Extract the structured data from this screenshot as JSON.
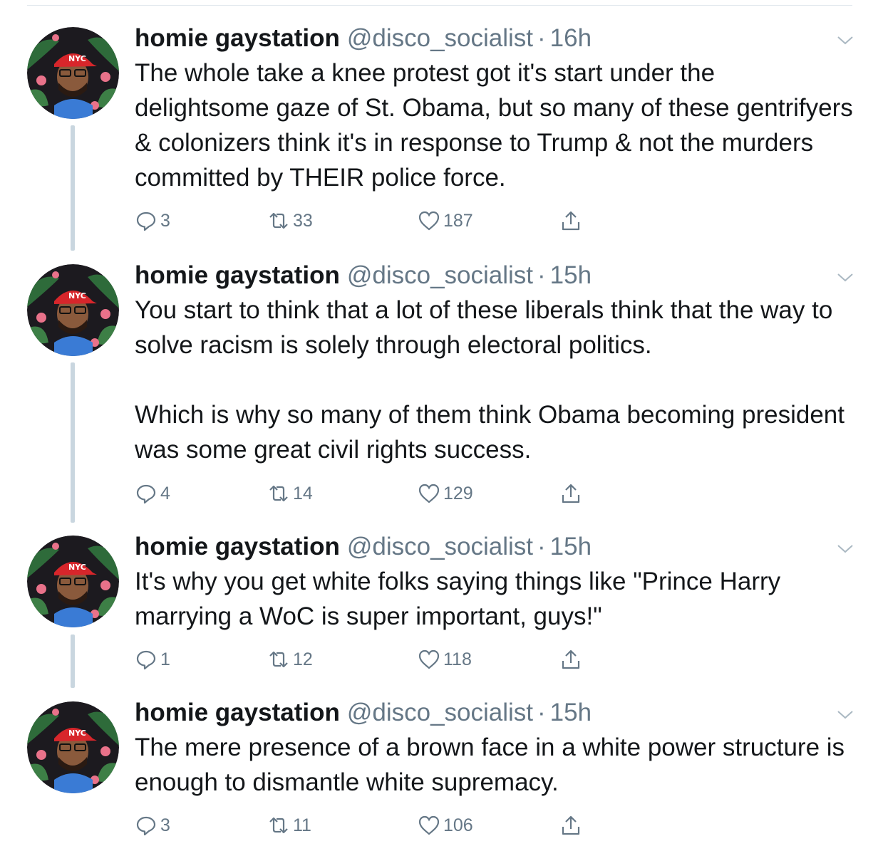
{
  "tweets": [
    {
      "name": "homie gaystation",
      "handle": "@disco_socialist",
      "separator": "·",
      "time": "16h",
      "text": "The whole take a knee protest got it's start under the delightsome gaze of St. Obama, but so many of these gentrifyers & colonizers think it's in response to Trump & not the murders committed by THEIR police force.",
      "replies": "3",
      "retweets": "33",
      "likes": "187"
    },
    {
      "name": "homie gaystation",
      "handle": "@disco_socialist",
      "separator": "·",
      "time": "15h",
      "text": "You start to think that a lot of these liberals think that the way to solve racism is solely through electoral politics.\n\nWhich is why so many of them think Obama becoming president was some great civil rights success.",
      "replies": "4",
      "retweets": "14",
      "likes": "129"
    },
    {
      "name": "homie gaystation",
      "handle": "@disco_socialist",
      "separator": "·",
      "time": "15h",
      "text": "It's why you get white folks saying things like \"Prince Harry marrying a WoC is super important, guys!\"",
      "replies": "1",
      "retweets": "12",
      "likes": "118"
    },
    {
      "name": "homie gaystation",
      "handle": "@disco_socialist",
      "separator": "·",
      "time": "15h",
      "text": "The mere presence of a brown face in a white power structure is enough to dismantle white supremacy.",
      "replies": "3",
      "retweets": "11",
      "likes": "106"
    }
  ],
  "avatar": {
    "cap_logo_text": "NYC",
    "colors": {
      "cap": "#d7262b",
      "foliage": "#2e6b3a",
      "background": "#1c1a1f",
      "flower": "#e9728a",
      "shirt": "#3a7bd5",
      "skin": "#8a5a3c"
    }
  },
  "icons": {
    "reply": "reply-icon",
    "retweet": "retweet-icon",
    "like": "heart-icon",
    "share": "share-icon",
    "more": "chevron-down-icon"
  },
  "colors": {
    "text": "#14171a",
    "secondary": "#657786",
    "thread_line": "#c9d6df",
    "divider": "#e1e8ed"
  }
}
